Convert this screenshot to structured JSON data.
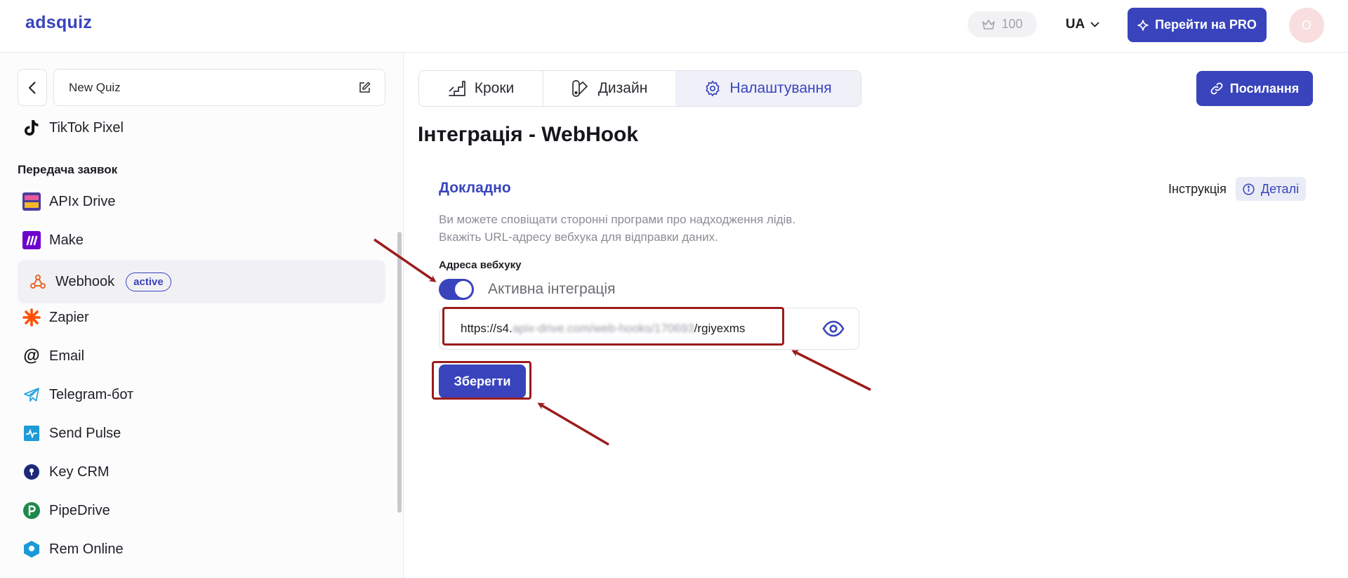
{
  "header": {
    "logo": "adsquiz",
    "credits": "100",
    "language": "UA",
    "pro_button": "Перейти на PRO",
    "avatar_initial": "O"
  },
  "sidebar": {
    "quiz_name": "New Quiz",
    "tiktok": "TikTok Pixel",
    "section_title": "Передача заявок",
    "items": [
      {
        "label": "APIx Drive"
      },
      {
        "label": "Make"
      },
      {
        "label": "Webhook",
        "badge": "active"
      },
      {
        "label": "Zapier"
      },
      {
        "label": "Email"
      },
      {
        "label": "Telegram-бот"
      },
      {
        "label": "Send Pulse"
      },
      {
        "label": "Key CRM"
      },
      {
        "label": "PipeDrive"
      },
      {
        "label": "Rem Online"
      }
    ]
  },
  "tabs": [
    {
      "label": "Кроки"
    },
    {
      "label": "Дизайн"
    },
    {
      "label": "Налаштування"
    }
  ],
  "link_button": "Посилання",
  "page_title": "Інтеграція - WebHook",
  "details": {
    "title": "Докладно",
    "instruction": "Інструкція",
    "details_button": "Деталі",
    "desc_line1": "Ви можете сповіщати сторонні програми про надходження лідів.",
    "desc_line2": "Вкажіть URL-адресу вебхука для відправки даних."
  },
  "webhook": {
    "field_label": "Адреса вебхуку",
    "toggle_label": "Активна інтеграція",
    "toggle_on": true,
    "url_prefix": "https://s4.",
    "url_blurred": "apix-drive.com/web-hooks/170693",
    "url_suffix": "/rgiyexms"
  },
  "save_button": "Зберегти",
  "colors": {
    "accent": "#3944bc",
    "annotation": "#9b1c1c"
  }
}
